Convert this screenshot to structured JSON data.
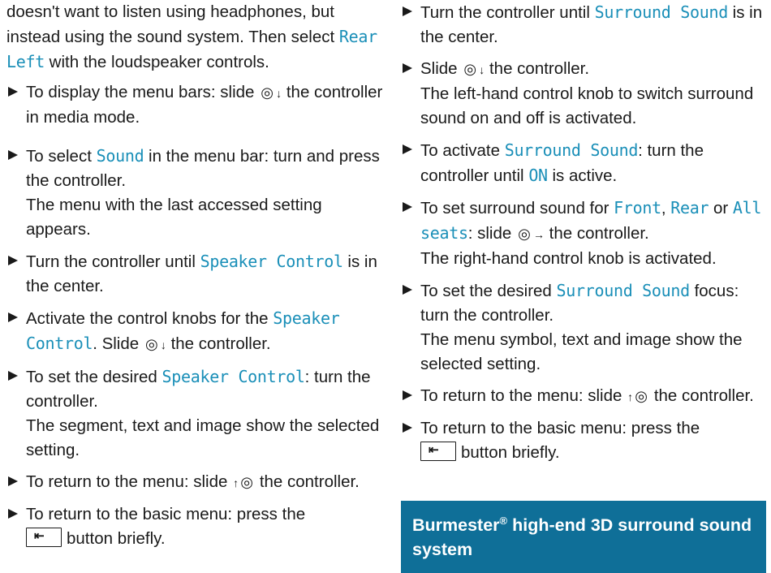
{
  "left": {
    "intro": [
      "doesn't want to listen using headphones, but instead using the sound system. Then select ",
      "Rear Left",
      " with the loudspeaker controls."
    ],
    "items": [
      {
        "parts": [
          "To display the menu bars: slide ",
          "the controller in media mode."
        ]
      },
      {
        "parts": [
          "To select ",
          "Sound",
          " in the menu bar: turn and press the controller.",
          "The menu with the last accessed setting appears."
        ]
      },
      {
        "parts": [
          "Turn the controller until ",
          "Speaker Control",
          " is in the center."
        ]
      },
      {
        "parts": [
          "Activate the control knobs for the ",
          "Speaker Control",
          ". Slide ",
          "the controller."
        ]
      },
      {
        "parts": [
          "To set the desired ",
          "Speaker Control",
          ": turn the controller.",
          "The segment, text and image show the selected setting."
        ]
      },
      {
        "parts": [
          "To return to the menu: slide ",
          "the controller."
        ]
      },
      {
        "parts": [
          "To return to the basic menu: press the ",
          "button briefly."
        ]
      }
    ]
  },
  "right": {
    "items": [
      {
        "parts": [
          "Turn the controller until ",
          "Surround Sound",
          " is in the center."
        ]
      },
      {
        "parts": [
          "Slide ",
          "the controller.",
          "The left-hand control knob to switch surround sound on and off is activated."
        ]
      },
      {
        "parts": [
          "To activate ",
          "Surround Sound",
          ": turn the controller until ",
          "ON",
          " is active."
        ]
      },
      {
        "parts": [
          "To set surround sound for ",
          "Front",
          ", ",
          "Rear",
          " or ",
          "All seats",
          ": slide ",
          "the controller.",
          "The right-hand control knob is activated."
        ]
      },
      {
        "parts": [
          "To set the desired ",
          "Surround Sound",
          " focus: turn the controller.",
          "The menu symbol, text and image show the selected setting."
        ]
      },
      {
        "parts": [
          "To return to the menu: slide ",
          "the controller."
        ]
      },
      {
        "parts": [
          "To return to the basic menu: press the ",
          "button briefly."
        ]
      }
    ]
  },
  "section_header": {
    "title": "Burmester",
    "sup": "®",
    "rest": " high-end 3D surround sound system"
  },
  "icons": {
    "controller": "◎",
    "arrow_down": "↓",
    "arrow_up": "↑",
    "arrow_right": "→",
    "back": "⇤",
    "bullet": "▶"
  },
  "colors": {
    "menu_text": "#1a8fb8",
    "header_bg": "#0f6f98"
  }
}
